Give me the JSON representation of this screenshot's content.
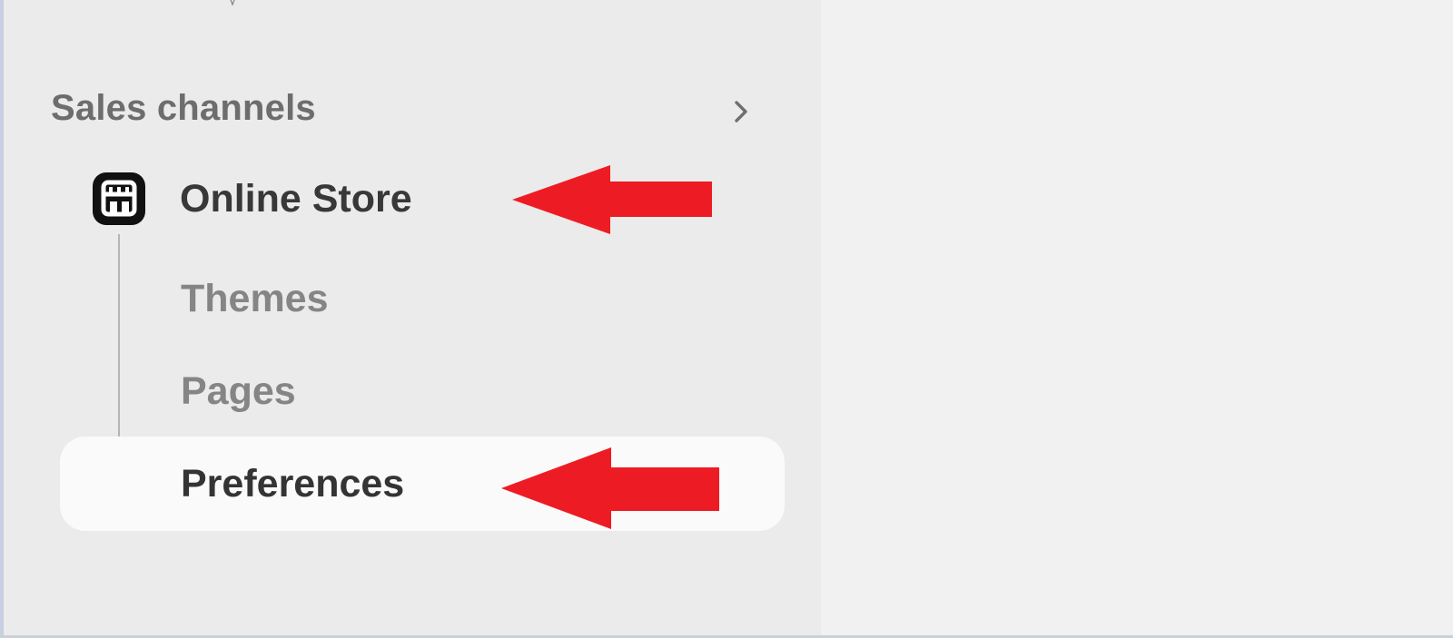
{
  "sidebar": {
    "top_stub": "y",
    "sales_channels": {
      "title": "Sales channels",
      "chevron_icon": "chevron-right-icon"
    },
    "online_store": {
      "label": "Online Store",
      "icon": "storefront-icon"
    },
    "subitems": [
      {
        "label": "Themes"
      },
      {
        "label": "Pages"
      },
      {
        "label": "Preferences",
        "selected": true
      }
    ]
  },
  "annotations": {
    "arrow_color": "#ed1c24",
    "arrow_icon": "left-arrow-annotation"
  },
  "colors": {
    "sidebar_background": "#ebebeb",
    "main_background": "#f1f1f1",
    "selected_item_background": "#fafafa",
    "heading_text": "#6d6d6d",
    "primary_text": "#343434",
    "secondary_text": "#858585"
  }
}
